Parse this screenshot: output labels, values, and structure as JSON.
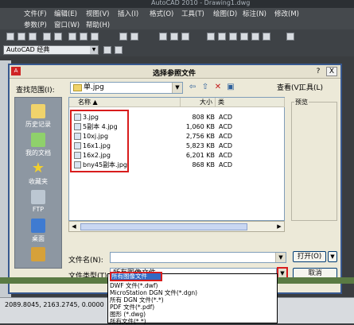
{
  "app": {
    "title": "AutoCAD 2010 - Drawing1.dwg",
    "menu_row1": [
      "文件(F)",
      "编辑(E)",
      "视图(V)",
      "插入(I)",
      "格式(O)",
      "工具(T)",
      "绘图(D)",
      "标注(N)",
      "修改(M)"
    ],
    "menu_row2": [
      "参数(P)",
      "窗口(W)",
      "帮助(H)"
    ],
    "workspace": "AutoCAD 经典",
    "status_coords": "2089.8045, 2163.2745, 0.0000"
  },
  "dialog": {
    "title": "选择参照文件",
    "help": "?",
    "close": "X",
    "lookin_label": "查找范围(I):",
    "lookin_value": "单.jpg",
    "view_label": "查看(V)",
    "tools_label": "工具(L)",
    "preview_label": "预览",
    "places": [
      "历史记录",
      "我的文档",
      "收藏夹",
      "FTP",
      "桌面",
      ""
    ],
    "columns": {
      "name": "名称",
      "size": "大小",
      "type": "类"
    },
    "files": [
      {
        "name": "3.jpg",
        "size": "808 KB",
        "type": "ACD"
      },
      {
        "name": "5副本 4.jpg",
        "size": "1,060 KB",
        "type": "ACD"
      },
      {
        "name": "10xj.jpg",
        "size": "2,756 KB",
        "type": "ACD"
      },
      {
        "name": "16x1.jpg",
        "size": "5,823 KB",
        "type": "ACD"
      },
      {
        "name": "16x2.jpg",
        "size": "6,201 KB",
        "type": "ACD"
      },
      {
        "name": "bny45副本.jpg",
        "size": "868 KB",
        "type": "ACD"
      }
    ],
    "filename_label": "文件名(N):",
    "filename_value": "",
    "filetype_label": "文件类型(T):",
    "filetype_value": "所有图像文件",
    "open_button": "打开(O)",
    "cancel_button": "取消",
    "filetype_options": [
      "所有图像文件",
      "DWF 文件(*.dwf)",
      "MicroStation DGN 文件(*.dgn)",
      "所有 DGN 文件(*.*)",
      "PDF 文件(*.pdf)",
      "图形 (*.dwg)",
      "所有文件(*.*)"
    ]
  },
  "colors": {
    "highlight": "#d81c1c",
    "dialog_bg": "#ece9d8",
    "selection": "#316ac5"
  }
}
